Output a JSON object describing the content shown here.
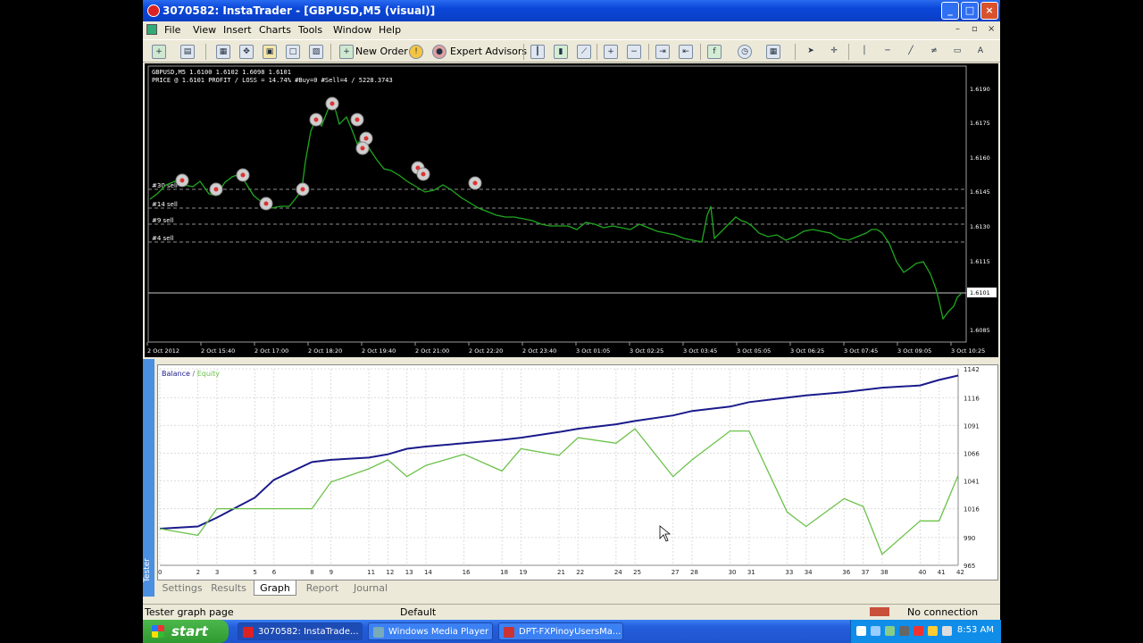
{
  "window": {
    "title": "3070582: InstaTrader - [GBPUSD,M5 (visual)]",
    "buttons": [
      "_",
      "□",
      "×"
    ]
  },
  "menu": {
    "items": [
      "File",
      "View",
      "Insert",
      "Charts",
      "Tools",
      "Window",
      "Help"
    ],
    "mdi_buttons": [
      "–",
      "▫",
      "×"
    ]
  },
  "toolbar": {
    "new_order": "New Order",
    "expert_advisors": "Expert Advisors"
  },
  "chart": {
    "header_line1": "GBPUSD,M5  1.6100 1.6102 1.6098 1.6101",
    "header_line2": "PRICE @ 1.6101  PROFIT / LOSS = 14.74%  #Buy=0  #Sell=4  /  5228.3743",
    "price_ticks": [
      "1.6190",
      "1.6175",
      "1.6160",
      "1.6145",
      "1.6130",
      "1.6115",
      "1.6101",
      "1.6085"
    ],
    "time_ticks": [
      "2 Oct 2012",
      "2 Oct 15:40",
      "2 Oct 17:00",
      "2 Oct 18:20",
      "2 Oct 19:40",
      "2 Oct 21:00",
      "2 Oct 22:20",
      "2 Oct 23:40",
      "3 Oct 01:05",
      "3 Oct 02:25",
      "3 Oct 03:45",
      "3 Oct 05:05",
      "3 Oct 06:25",
      "3 Oct 07:45",
      "3 Oct 09:05",
      "3 Oct 10:25"
    ],
    "order_labels": [
      "#30 sell",
      "#14 sell",
      "#9 sell",
      "#4 sell"
    ],
    "current_price": "1.6101",
    "line_color": "#1fa81f"
  },
  "tester": {
    "side_tab": "Tester",
    "tabs": [
      "Settings",
      "Results",
      "Graph",
      "Report",
      "Journal"
    ],
    "active_tab": "Graph"
  },
  "chart_data": {
    "type": "line",
    "legend": {
      "balance": "Balance",
      "separator": " / ",
      "equity": "Equity"
    },
    "legend_placement": "top-left",
    "x_ticks": [
      "0",
      "2",
      "3",
      "5",
      "6",
      "8",
      "9",
      "11",
      "12",
      "13",
      "14",
      "16",
      "18",
      "19",
      "21",
      "22",
      "24",
      "25",
      "27",
      "28",
      "30",
      "31",
      "33",
      "34",
      "36",
      "37",
      "38",
      "40",
      "41",
      "42"
    ],
    "y_ticks": [
      "1142",
      "1116",
      "1091",
      "1066",
      "1041",
      "1016",
      "990",
      "965"
    ],
    "ylim": [
      965,
      1142
    ],
    "grid": true,
    "series": [
      {
        "name": "Balance",
        "color": "#1a1a8c",
        "x": [
          0,
          2,
          3,
          5,
          6,
          8,
          9,
          11,
          12,
          13,
          14,
          16,
          18,
          19,
          21,
          22,
          24,
          25,
          27,
          28,
          30,
          31,
          33,
          34,
          36,
          37,
          38,
          40,
          41,
          42
        ],
        "values": [
          998,
          1000,
          1008,
          1026,
          1042,
          1058,
          1060,
          1062,
          1065,
          1070,
          1072,
          1075,
          1078,
          1080,
          1085,
          1088,
          1092,
          1095,
          1100,
          1104,
          1108,
          1112,
          1116,
          1118,
          1121,
          1123,
          1125,
          1127,
          1132,
          1136
        ]
      },
      {
        "name": "Equity",
        "color": "#6cc24a",
        "x": [
          0,
          2,
          3,
          5,
          6,
          8,
          9,
          11,
          12,
          13,
          14,
          16,
          18,
          19,
          21,
          22,
          24,
          25,
          27,
          28,
          30,
          31,
          33,
          34,
          36,
          37,
          38,
          40,
          41,
          42
        ],
        "values": [
          998,
          992,
          1016,
          1016,
          1016,
          1016,
          1040,
          1052,
          1060,
          1045,
          1055,
          1065,
          1050,
          1070,
          1064,
          1080,
          1075,
          1088,
          1045,
          1060,
          1086,
          1086,
          1013,
          1000,
          1025,
          1018,
          975,
          1005,
          1005,
          1046
        ]
      }
    ]
  },
  "status": {
    "left": "Tester graph page",
    "profile": "Default",
    "connection": "No connection"
  },
  "taskbar": {
    "start": "start",
    "tasks": [
      "3070582: InstaTrade...",
      "Windows Media Player",
      "DPT-FXPinoyUsersMa..."
    ],
    "clock": "8:53 AM"
  }
}
